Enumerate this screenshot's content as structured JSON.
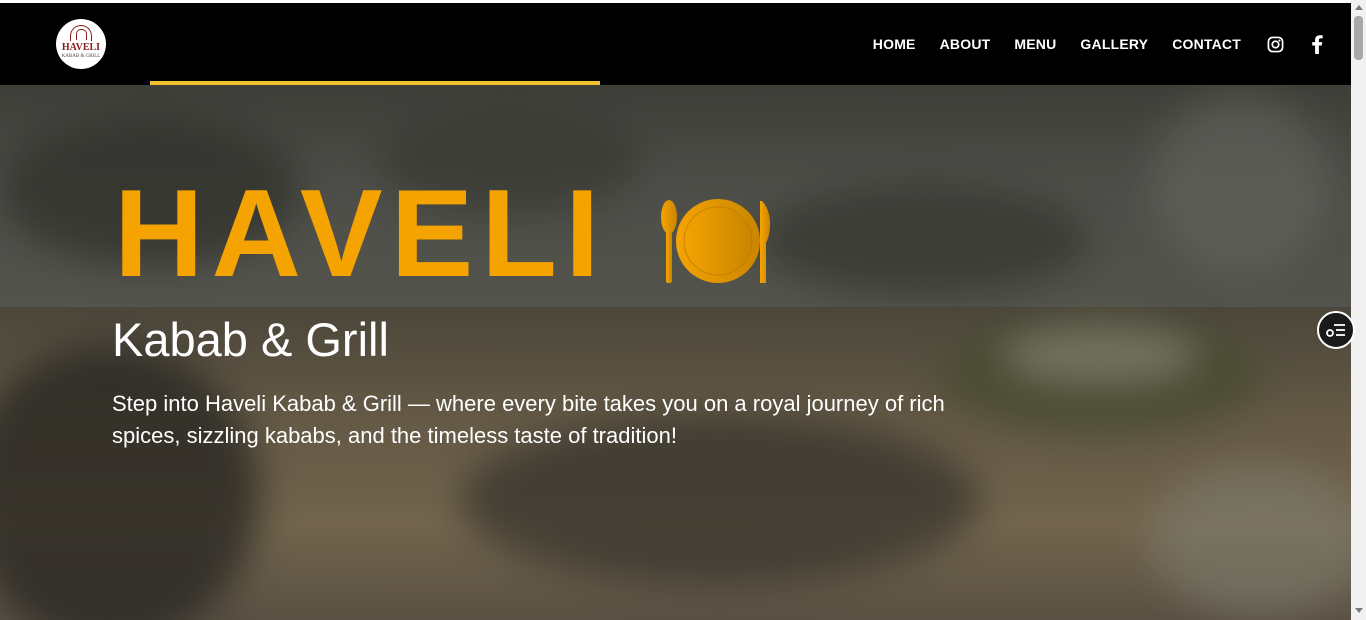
{
  "brand": {
    "logo_text": "HAVELI",
    "logo_subtext": "KABAB & GRILL"
  },
  "nav": {
    "links": [
      {
        "label": "HOME"
      },
      {
        "label": "ABOUT"
      },
      {
        "label": "MENU"
      },
      {
        "label": "GALLERY"
      },
      {
        "label": "CONTACT"
      }
    ],
    "icons": [
      "instagram-icon",
      "facebook-icon"
    ]
  },
  "hero": {
    "title": "HAVELI",
    "title_icon": "plate-cutlery-icon",
    "subtitle": "Kabab & Grill",
    "text": "Step into Haveli Kabab & Grill — where every bite takes you on a royal journey of rich spices, sizzling kababs, and the timeless taste of tradition!"
  },
  "colors": {
    "accent": "#f5a300",
    "progress": "#f2c12e",
    "nav_bg": "#000000",
    "nav_text": "#ffffff"
  },
  "side_widget": {
    "icon": "settings-list-icon"
  }
}
